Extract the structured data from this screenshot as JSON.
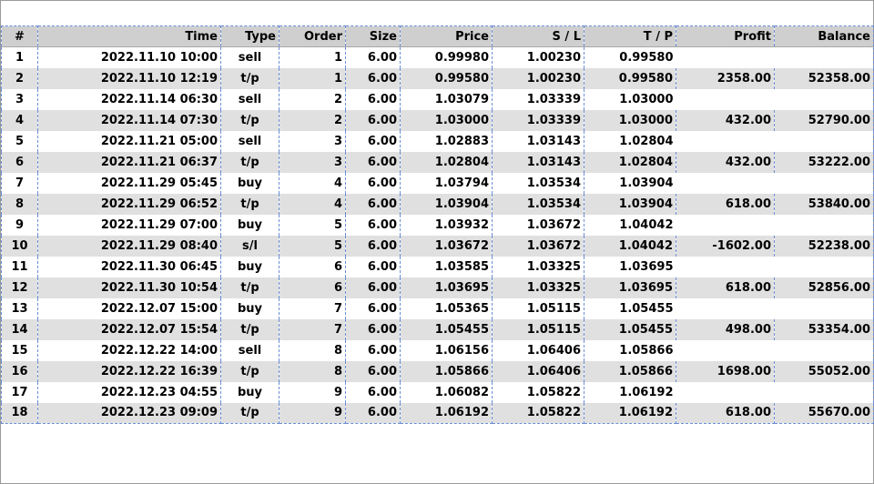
{
  "headers": [
    "#",
    "Time",
    "Type",
    "Order",
    "Size",
    "Price",
    "S / L",
    "T / P",
    "Profit",
    "Balance"
  ],
  "rows": [
    {
      "num": "1",
      "time": "2022.11.10 10:00",
      "type": "sell",
      "order": "1",
      "size": "6.00",
      "price": "0.99980",
      "sl": "1.00230",
      "tp": "0.99580",
      "profit": "",
      "balance": ""
    },
    {
      "num": "2",
      "time": "2022.11.10 12:19",
      "type": "t/p",
      "order": "1",
      "size": "6.00",
      "price": "0.99580",
      "sl": "1.00230",
      "tp": "0.99580",
      "profit": "2358.00",
      "balance": "52358.00"
    },
    {
      "num": "3",
      "time": "2022.11.14 06:30",
      "type": "sell",
      "order": "2",
      "size": "6.00",
      "price": "1.03079",
      "sl": "1.03339",
      "tp": "1.03000",
      "profit": "",
      "balance": ""
    },
    {
      "num": "4",
      "time": "2022.11.14 07:30",
      "type": "t/p",
      "order": "2",
      "size": "6.00",
      "price": "1.03000",
      "sl": "1.03339",
      "tp": "1.03000",
      "profit": "432.00",
      "balance": "52790.00"
    },
    {
      "num": "5",
      "time": "2022.11.21 05:00",
      "type": "sell",
      "order": "3",
      "size": "6.00",
      "price": "1.02883",
      "sl": "1.03143",
      "tp": "1.02804",
      "profit": "",
      "balance": ""
    },
    {
      "num": "6",
      "time": "2022.11.21 06:37",
      "type": "t/p",
      "order": "3",
      "size": "6.00",
      "price": "1.02804",
      "sl": "1.03143",
      "tp": "1.02804",
      "profit": "432.00",
      "balance": "53222.00"
    },
    {
      "num": "7",
      "time": "2022.11.29 05:45",
      "type": "buy",
      "order": "4",
      "size": "6.00",
      "price": "1.03794",
      "sl": "1.03534",
      "tp": "1.03904",
      "profit": "",
      "balance": ""
    },
    {
      "num": "8",
      "time": "2022.11.29 06:52",
      "type": "t/p",
      "order": "4",
      "size": "6.00",
      "price": "1.03904",
      "sl": "1.03534",
      "tp": "1.03904",
      "profit": "618.00",
      "balance": "53840.00"
    },
    {
      "num": "9",
      "time": "2022.11.29 07:00",
      "type": "buy",
      "order": "5",
      "size": "6.00",
      "price": "1.03932",
      "sl": "1.03672",
      "tp": "1.04042",
      "profit": "",
      "balance": ""
    },
    {
      "num": "10",
      "time": "2022.11.29 08:40",
      "type": "s/l",
      "order": "5",
      "size": "6.00",
      "price": "1.03672",
      "sl": "1.03672",
      "tp": "1.04042",
      "profit": "-1602.00",
      "balance": "52238.00"
    },
    {
      "num": "11",
      "time": "2022.11.30 06:45",
      "type": "buy",
      "order": "6",
      "size": "6.00",
      "price": "1.03585",
      "sl": "1.03325",
      "tp": "1.03695",
      "profit": "",
      "balance": ""
    },
    {
      "num": "12",
      "time": "2022.11.30 10:54",
      "type": "t/p",
      "order": "6",
      "size": "6.00",
      "price": "1.03695",
      "sl": "1.03325",
      "tp": "1.03695",
      "profit": "618.00",
      "balance": "52856.00"
    },
    {
      "num": "13",
      "time": "2022.12.07 15:00",
      "type": "buy",
      "order": "7",
      "size": "6.00",
      "price": "1.05365",
      "sl": "1.05115",
      "tp": "1.05455",
      "profit": "",
      "balance": ""
    },
    {
      "num": "14",
      "time": "2022.12.07 15:54",
      "type": "t/p",
      "order": "7",
      "size": "6.00",
      "price": "1.05455",
      "sl": "1.05115",
      "tp": "1.05455",
      "profit": "498.00",
      "balance": "53354.00"
    },
    {
      "num": "15",
      "time": "2022.12.22 14:00",
      "type": "sell",
      "order": "8",
      "size": "6.00",
      "price": "1.06156",
      "sl": "1.06406",
      "tp": "1.05866",
      "profit": "",
      "balance": ""
    },
    {
      "num": "16",
      "time": "2022.12.22 16:39",
      "type": "t/p",
      "order": "8",
      "size": "6.00",
      "price": "1.05866",
      "sl": "1.06406",
      "tp": "1.05866",
      "profit": "1698.00",
      "balance": "55052.00"
    },
    {
      "num": "17",
      "time": "2022.12.23 04:55",
      "type": "buy",
      "order": "9",
      "size": "6.00",
      "price": "1.06082",
      "sl": "1.05822",
      "tp": "1.06192",
      "profit": "",
      "balance": ""
    },
    {
      "num": "18",
      "time": "2022.12.23 09:09",
      "type": "t/p",
      "order": "9",
      "size": "6.00",
      "price": "1.06192",
      "sl": "1.05822",
      "tp": "1.06192",
      "profit": "618.00",
      "balance": "55670.00"
    }
  ],
  "colors": {
    "header_bg": "#cfcfcf",
    "row_alt_bg": "#e0e0e0",
    "grid_line": "#6b8fd6"
  }
}
